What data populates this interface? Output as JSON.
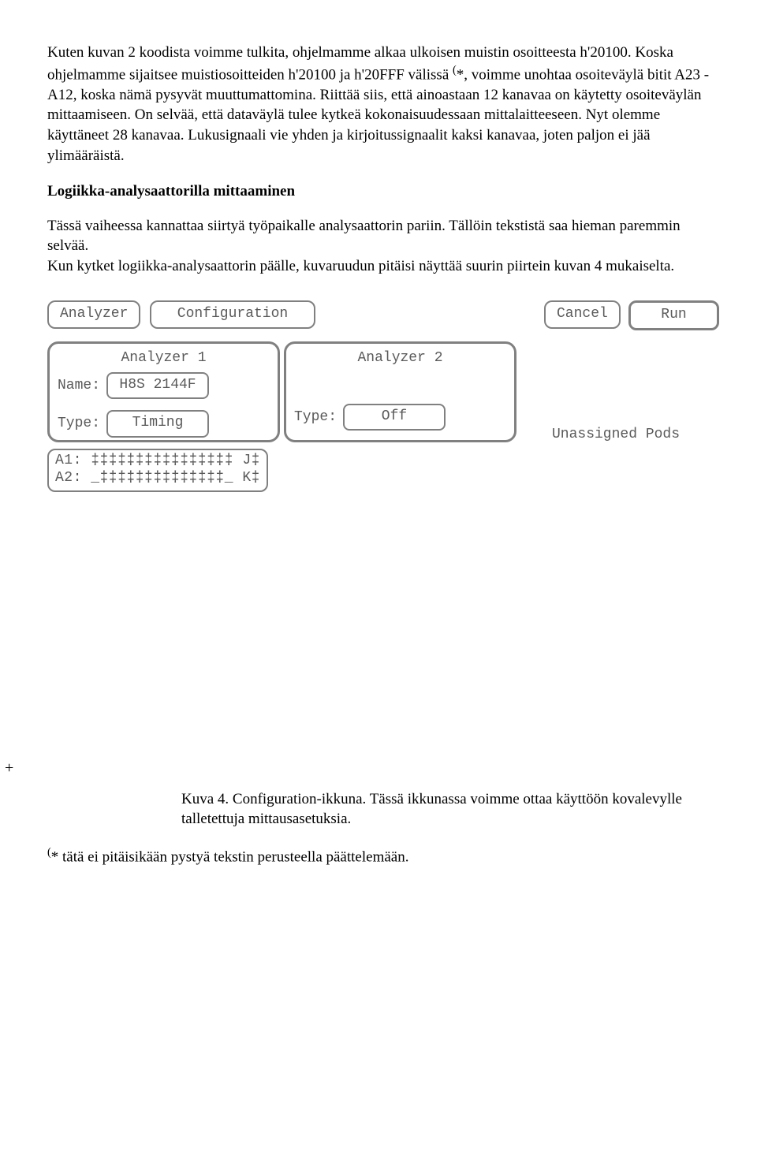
{
  "para1": "Kuten kuvan 2 koodista voimme tulkita, ohjelmamme alkaa ulkoisen muistin osoitteesta h'20100. Koska ohjelmamme sijaitsee muistiosoitteiden h'20100 ja h'20FFF välissä ",
  "para1_sup": "(",
  "para1_after": "*, voimme unohtaa osoiteväylä bitit A23 - A12, koska nämä pysyvät muuttumattomina. Riittää siis, että ainoastaan 12 kanavaa on käytetty osoiteväylän mittaamiseen. On selvää, että dataväylä tulee kytkeä kokonaisuudessaan mittalaitteeseen. Nyt olemme käyttäneet 28 kanavaa. Lukusignaali vie yhden ja kirjoitussignaalit kaksi kanavaa, joten paljon ei jää ylimääräistä.",
  "heading": "Logiikka-analysaattorilla mittaaminen",
  "para2": "Tässä vaiheessa kannattaa siirtyä työpaikalle analysaattorin pariin. Tällöin tekstistä saa hieman paremmin selvää.",
  "para3": "Kun kytket logiikka-analysaattorin päälle, kuvaruudun pitäisi näyttää suurin piirtein kuvan 4 mukaiselta.",
  "fig": {
    "analyzer_btn": "Analyzer",
    "config_btn": "Configuration",
    "cancel_btn": "Cancel",
    "run_btn": "Run",
    "panel1_title": "Analyzer 1",
    "panel2_title": "Analyzer 2",
    "name_label": "Name:",
    "name_value": "H8S 2144F",
    "type_label": "Type:",
    "type1_value": "Timing",
    "type2_value": "Off",
    "unassigned": "Unassigned Pods",
    "pods_a1": "A1: ‡‡‡‡‡‡‡‡‡‡‡‡‡‡‡‡  J‡",
    "pods_a2": "A2: _‡‡‡‡‡‡‡‡‡‡‡‡‡‡_  K‡"
  },
  "plus": "+",
  "caption": "Kuva 4. Configuration-ikkuna. Tässä ikkunassa voimme ottaa käyttöön kovalevylle talletettuja mittausasetuksia.",
  "footnote_sup": "(",
  "footnote": "* tätä ei pitäisikään pystyä tekstin perusteella päättelemään."
}
